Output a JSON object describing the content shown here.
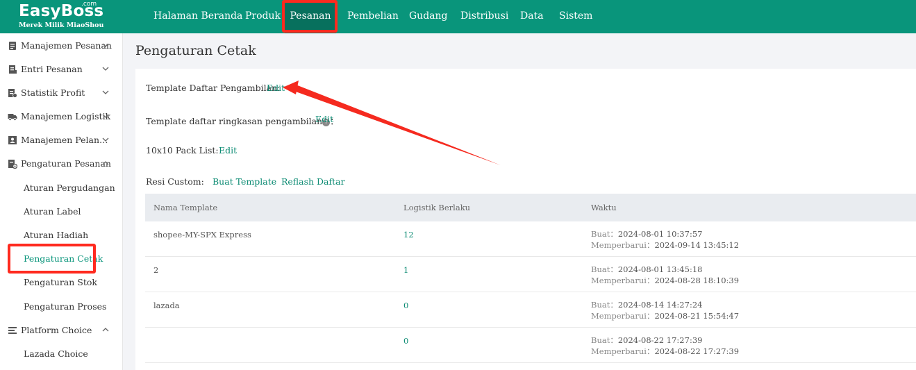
{
  "app": {
    "logo": "EasyBoss",
    "logo_com": ".com",
    "logo_sub": "Merek Milik MiaoShou"
  },
  "nav": {
    "items": [
      {
        "label": "Halaman Beranda"
      },
      {
        "label": "Produk"
      },
      {
        "label": "Pesanan"
      },
      {
        "label": "Pembelian"
      },
      {
        "label": "Gudang"
      },
      {
        "label": "Distribusi"
      },
      {
        "label": "Data"
      },
      {
        "label": "Sistem"
      }
    ]
  },
  "sidebar": {
    "groups": [
      {
        "label": "Manajemen Pesanan",
        "icon": "clipboard-icon"
      },
      {
        "label": "Entri Pesanan",
        "icon": "document-icon"
      },
      {
        "label": "Statistik Profit",
        "icon": "chart-icon"
      },
      {
        "label": "Manajemen Logistik",
        "icon": "truck-icon"
      },
      {
        "label": "Manajemen Pelan…",
        "icon": "contacts-icon"
      },
      {
        "label": "Pengaturan Pesanan",
        "icon": "settings-doc-icon"
      },
      {
        "label": "Platform Choice",
        "icon": "layers-icon"
      }
    ],
    "sub_items": [
      {
        "label": "Aturan Pergudangan"
      },
      {
        "label": "Aturan Label"
      },
      {
        "label": "Aturan Hadiah"
      },
      {
        "label": "Pengaturan Cetak"
      },
      {
        "label": "Pengaturan Stok"
      },
      {
        "label": "Pengaturan Proses"
      }
    ],
    "platform_sub": {
      "label": "Lazada Choice"
    }
  },
  "page": {
    "title": "Pengaturan Cetak",
    "picklist_label": "Template Daftar Pengambilan:",
    "picklist_edit": "Edit",
    "summary_label": "Template daftar ringkasan pengambilan",
    "summary_colon": "：",
    "summary_edit": "Edit",
    "pack_label": "10x10 Pack List:",
    "pack_edit": "Edit",
    "resi_label": "Resi Custom:",
    "resi_create": "Buat Template",
    "resi_refresh": "Reflash Daftar"
  },
  "table": {
    "headers": [
      "Nama Template",
      "Logistik Berlaku",
      "Waktu"
    ],
    "created_label": "Buat：",
    "updated_label": "Memperbarui：",
    "rows": [
      {
        "name": "shopee-MY-SPX Express",
        "logistics": "12",
        "created": "2024-08-01 10:37:57",
        "updated": "2024-09-14 13:45:12"
      },
      {
        "name": "2",
        "logistics": "1",
        "created": "2024-08-01 13:45:18",
        "updated": "2024-08-28 18:10:39"
      },
      {
        "name": "lazada",
        "logistics": "0",
        "created": "2024-08-14 14:27:24",
        "updated": "2024-08-21 15:54:47"
      },
      {
        "name": "",
        "logistics": "0",
        "created": "2024-08-22 17:27:39",
        "updated": "2024-08-22 17:27:39"
      }
    ]
  },
  "colors": {
    "brand": "#09957b",
    "nav_active": "#07705d",
    "link": "#0c8b73",
    "highlight": "#ff2a1f"
  }
}
